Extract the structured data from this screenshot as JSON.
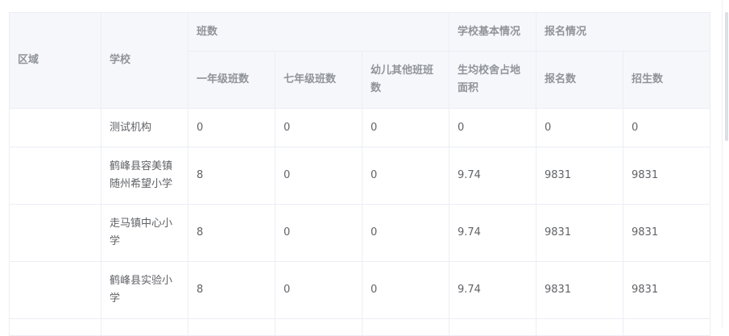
{
  "table": {
    "header": {
      "area": "区域",
      "school": "学校",
      "groups": {
        "classes": "班数",
        "basic": "学校基本情况",
        "enroll": "报名情况"
      },
      "sub": {
        "grade1_classes": "一年级班数",
        "grade7_classes": "七年级班数",
        "kinder_other_classes": "幼儿其他班班数",
        "area_per_student": "生均校舍占地面积",
        "signup_count": "报名数",
        "admit_count": "招生数"
      }
    },
    "rows": [
      {
        "area": "",
        "school": "测试机构",
        "grade1": "0",
        "grade7": "0",
        "kinder": "0",
        "area_per_student": "0",
        "signup": "0",
        "admit": "0"
      },
      {
        "area": "",
        "school": "鹤峰县容美镇随州希望小学",
        "grade1": "8",
        "grade7": "0",
        "kinder": "0",
        "area_per_student": "9.74",
        "signup": "9831",
        "admit": "9831"
      },
      {
        "area": "",
        "school": "走马镇中心小学",
        "grade1": "8",
        "grade7": "0",
        "kinder": "0",
        "area_per_student": "9.74",
        "signup": "9831",
        "admit": "9831"
      },
      {
        "area": "",
        "school": "鹤峰县实验小学",
        "grade1": "8",
        "grade7": "0",
        "kinder": "0",
        "area_per_student": "9.74",
        "signup": "9831",
        "admit": "9831"
      }
    ]
  }
}
